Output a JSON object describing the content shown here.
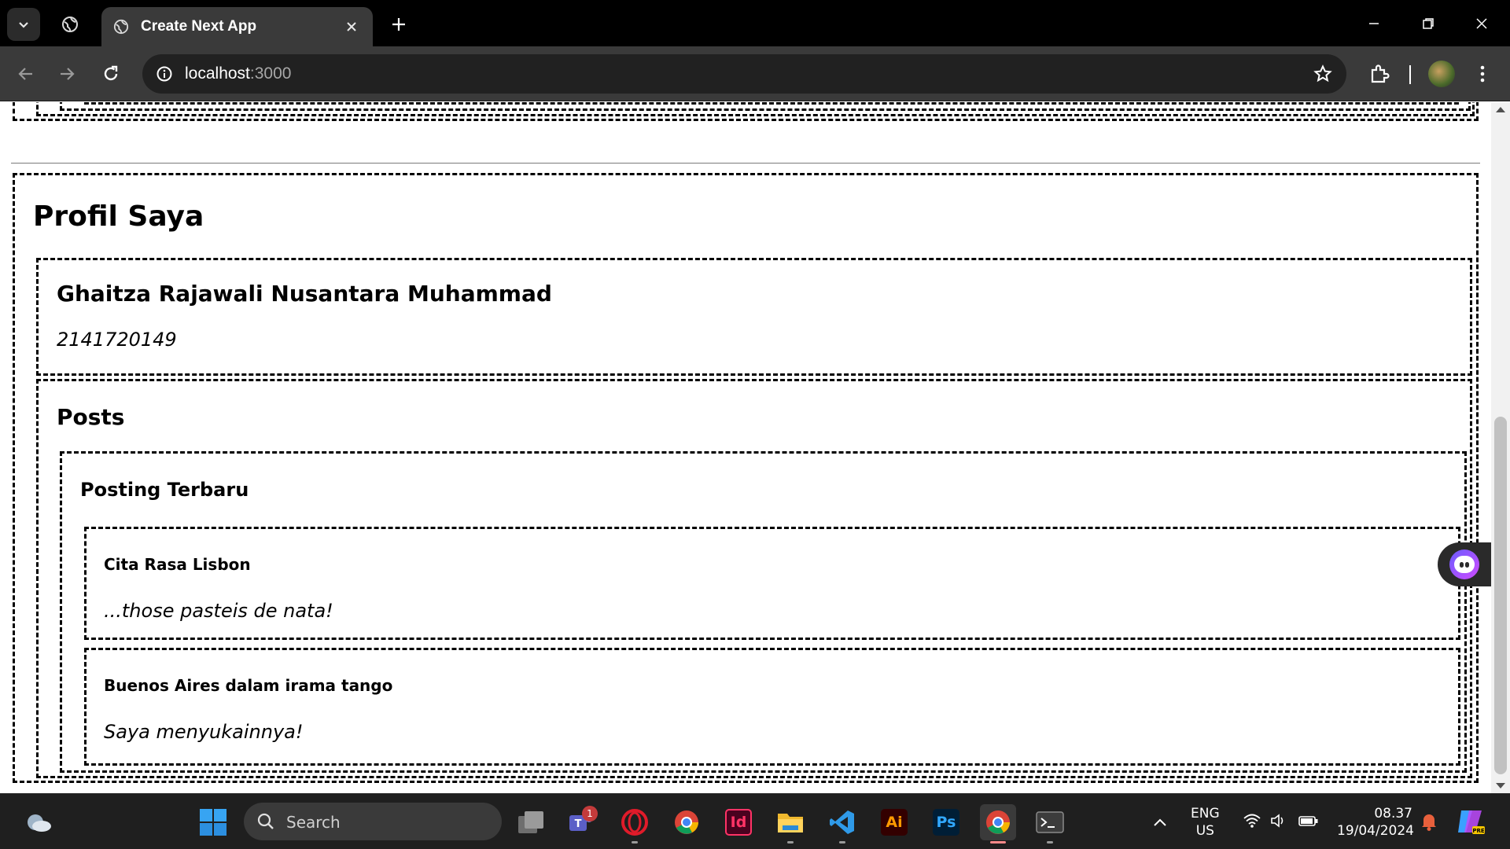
{
  "browser": {
    "tab_title": "Create Next App",
    "url_host": "localhost",
    "url_port": ":3000",
    "icons": [
      "tab-list-icon",
      "globe-icon",
      "close-icon",
      "plus-icon",
      "minimize-icon",
      "restore-icon",
      "close-icon",
      "back-icon",
      "forward-icon",
      "reload-icon",
      "site-info-icon",
      "star-icon",
      "extensions-icon",
      "kebab-menu-icon"
    ]
  },
  "page": {
    "title": "Profil Saya",
    "profile": {
      "name": "Ghaitza Rajawali Nusantara Muhammad",
      "nim": "2141720149"
    },
    "posts_title": "Posts",
    "latest_title": "Posting Terbaru",
    "posts": [
      {
        "title": "Cita Rasa Lisbon",
        "body": "...those pasteis de nata!"
      },
      {
        "title": "Buenos Aires dalam irama tango",
        "body": "Saya menyukainnya!"
      }
    ]
  },
  "taskbar": {
    "search_label": "Search",
    "teams_badge": "1",
    "lang_line1": "ENG",
    "lang_line2": "US",
    "time": "08.37",
    "date": "19/04/2024",
    "indesign_label": "Id",
    "illustrator_label": "Ai",
    "photoshop_label": "Ps"
  },
  "colors": {
    "tabbar_bg": "#000000",
    "toolbar_bg": "#3a3a3a",
    "omnibox_bg": "#212121",
    "taskbar_bg": "#1f1f1f",
    "page_bg": "#ffffff",
    "border": "#000000"
  }
}
